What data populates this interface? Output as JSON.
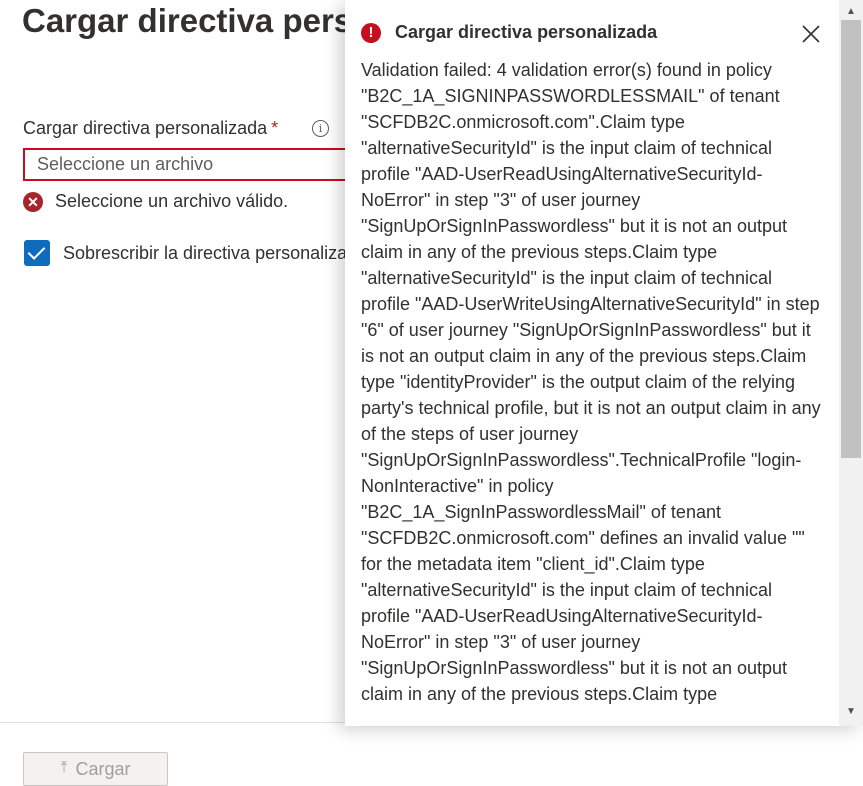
{
  "page": {
    "title": "Cargar directiva personalizada"
  },
  "form": {
    "file_label": "Cargar directiva personalizada",
    "required_mark": "*",
    "info_glyph": "i",
    "file_placeholder": "Seleccione un archivo",
    "error_message": "Seleccione un archivo válido.",
    "overwrite_label": "Sobrescribir la directiva personalizada si ya existe",
    "overwrite_checked": true,
    "upload_button": "Cargar"
  },
  "notification": {
    "title": "Cargar directiva personalizada",
    "close_icon": "close-icon",
    "status_icon": "error-icon",
    "message": "Validation failed: 4 validation error(s) found in policy \"B2C_1A_SIGNINPASSWORDLESSMAIL\" of tenant \"SCFDB2C.onmicrosoft.com\".Claim type \"alternativeSecurityId\" is the input claim of technical profile \"AAD-UserReadUsingAlternativeSecurityId-NoError\" in step \"3\" of user journey \"SignUpOrSignInPasswordless\" but it is not an output claim in any of the previous steps.Claim type \"alternativeSecurityId\" is the input claim of technical profile \"AAD-UserWriteUsingAlternativeSecurityId\" in step \"6\" of user journey \"SignUpOrSignInPasswordless\" but it is not an output claim in any of the previous steps.Claim type \"identityProvider\" is the output claim of the relying party's technical profile, but it is not an output claim in any of the steps of user journey \"SignUpOrSignInPasswordless\".TechnicalProfile \"login-NonInteractive\" in policy \"B2C_1A_SignInPasswordlessMail\" of tenant \"SCFDB2C.onmicrosoft.com\" defines an invalid value \"\" for the metadata item \"client_id\".Claim type \"alternativeSecurityId\" is the input claim of technical profile \"AAD-UserReadUsingAlternativeSecurityId-NoError\" in step \"3\" of user journey \"SignUpOrSignInPasswordless\" but it is not an output claim in any of the previous steps.Claim type"
  },
  "colors": {
    "accent": "#0f6cbd",
    "error": "#c50f1f"
  }
}
